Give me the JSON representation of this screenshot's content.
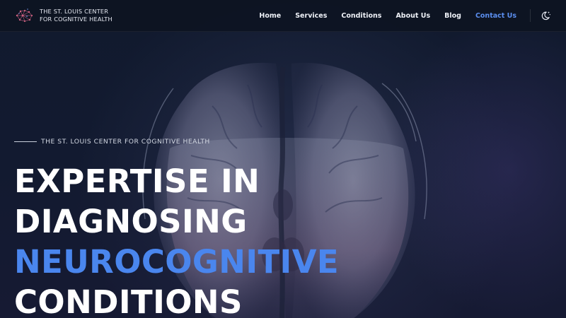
{
  "brand": {
    "line1": "THE ST. LOUIS CENTER",
    "line2": "FOR COGNITIVE HEALTH",
    "logo_icon": "brain-network-icon"
  },
  "nav": {
    "items": [
      {
        "label": "Home",
        "active": false
      },
      {
        "label": "Services",
        "active": false
      },
      {
        "label": "Conditions",
        "active": false
      },
      {
        "label": "About Us",
        "active": false
      },
      {
        "label": "Blog",
        "active": false
      },
      {
        "label": "Contact Us",
        "active": true
      }
    ],
    "theme_toggle_icon": "moon-stars-icon"
  },
  "hero": {
    "eyebrow": "THE ST. LOUIS CENTER FOR COGNITIVE HEALTH",
    "title_lines": [
      "EXPERTISE IN",
      "DIAGNOSING",
      "NEUROCOGNITIVE",
      "CONDITIONS"
    ],
    "accent_line_index": 2,
    "background_image": "brain-mri-scan"
  },
  "colors": {
    "background": "#111a2e",
    "accent": "#4a86ee",
    "nav_active": "#5b8ff0",
    "text": "#ffffff"
  }
}
